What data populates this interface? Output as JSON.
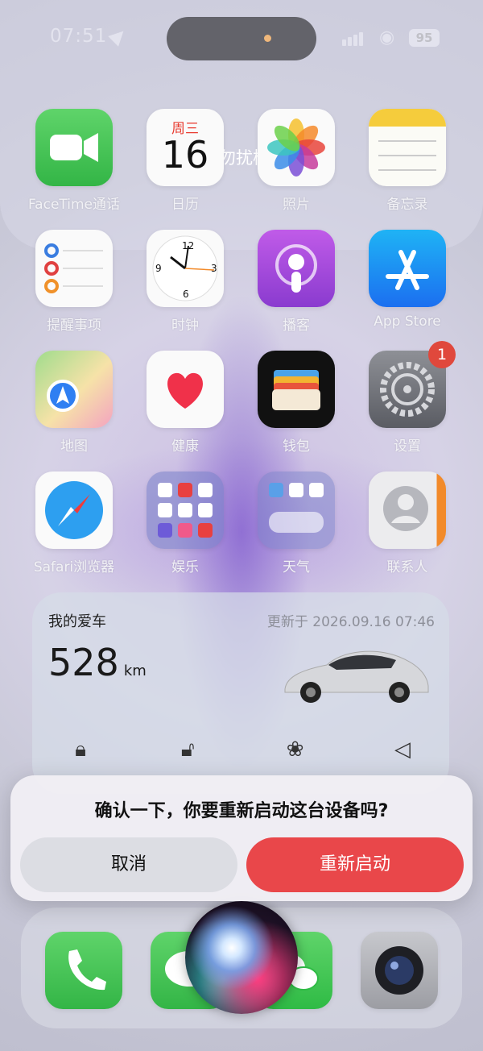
{
  "status_bar": {
    "time": "07:51",
    "battery": "95"
  },
  "focus": {
    "label": "勿扰模式"
  },
  "calendar": {
    "weekday": "周三",
    "day": "16"
  },
  "apps": [
    {
      "label": "FaceTime通话",
      "icon": "facetime-icon"
    },
    {
      "label": "日历",
      "icon": "calendar-icon"
    },
    {
      "label": "照片",
      "icon": "photos-icon"
    },
    {
      "label": "备忘录",
      "icon": "notes-icon"
    },
    {
      "label": "提醒事项",
      "icon": "reminders-icon"
    },
    {
      "label": "时钟",
      "icon": "clock-icon"
    },
    {
      "label": "播客",
      "icon": "podcasts-icon"
    },
    {
      "label": "App Store",
      "icon": "app-store-icon"
    },
    {
      "label": "地图",
      "icon": "maps-icon"
    },
    {
      "label": "健康",
      "icon": "health-icon"
    },
    {
      "label": "钱包",
      "icon": "wallet-icon"
    },
    {
      "label": "设置",
      "icon": "settings-icon",
      "badge": "1"
    },
    {
      "label": "Safari浏览器",
      "icon": "safari-icon"
    },
    {
      "label": "娱乐",
      "icon": "folder-icon"
    },
    {
      "label": "天气",
      "icon": "weather-folder-icon"
    },
    {
      "label": "联系人",
      "icon": "contacts-icon"
    }
  ],
  "car_widget": {
    "title": "我的爱车",
    "updated": "更新于 2026.09.16 07:46",
    "range_value": "528",
    "range_unit": "km",
    "controls": [
      "lock-icon",
      "unlock-icon",
      "fan-icon",
      "horn-icon"
    ]
  },
  "dialog": {
    "message": "确认一下，你要重新启动这台设备吗?",
    "cancel_label": "取消",
    "confirm_label": "重新启动"
  },
  "dock": [
    "phone-icon",
    "messages-icon",
    "wechat-icon",
    "camera-icon"
  ],
  "colors": {
    "accent_red": "#e9474a",
    "badge_red": "#e0483c"
  }
}
